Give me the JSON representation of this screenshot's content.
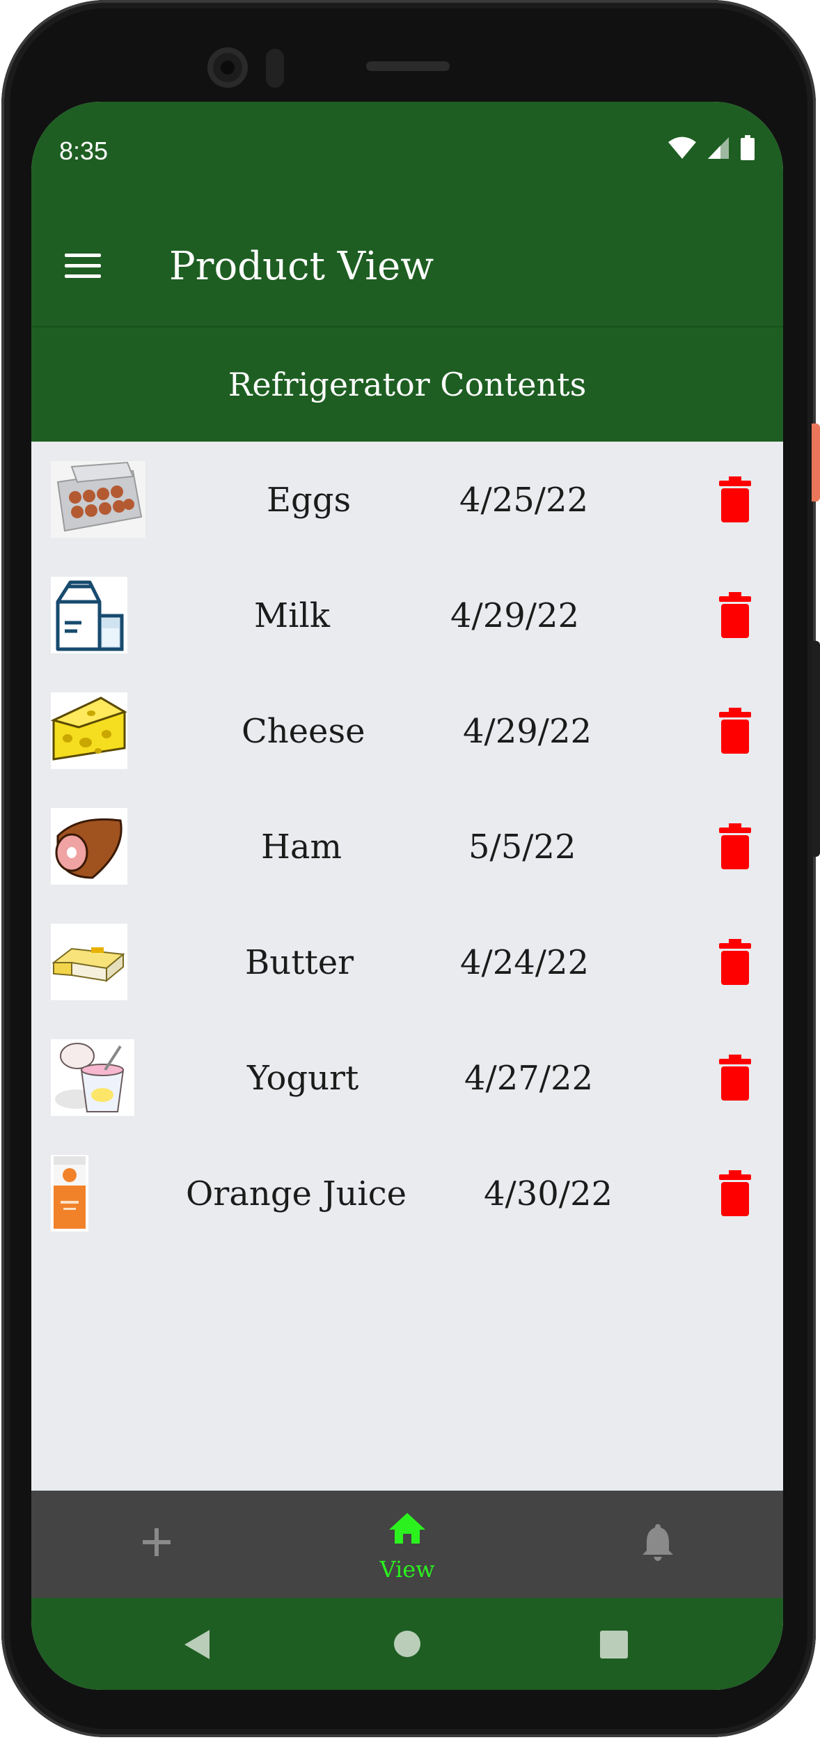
{
  "status_bar": {
    "time": "8:35"
  },
  "app_bar": {
    "title": "Product View",
    "menu_icon": "hamburger-menu-icon"
  },
  "subheader": {
    "title": "Refrigerator Contents"
  },
  "products": [
    {
      "name": "Eggs",
      "date": "4/25/22",
      "image": "eggs-carton"
    },
    {
      "name": "Milk",
      "date": "4/29/22",
      "image": "milk-carton"
    },
    {
      "name": "Cheese",
      "date": "4/29/22",
      "image": "cheese-wedge"
    },
    {
      "name": "Ham",
      "date": "5/5/22",
      "image": "ham"
    },
    {
      "name": "Butter",
      "date": "4/24/22",
      "image": "butter-stick"
    },
    {
      "name": "Yogurt",
      "date": "4/27/22",
      "image": "yogurt-cup"
    },
    {
      "name": "Orange Juice",
      "date": "4/30/22",
      "image": "orange-juice-carton"
    }
  ],
  "bottom_nav": {
    "items": [
      {
        "icon": "add-icon",
        "label": "",
        "active": false
      },
      {
        "icon": "home-icon",
        "label": "View",
        "active": true
      },
      {
        "icon": "bell-icon",
        "label": "",
        "active": false
      }
    ]
  },
  "colors": {
    "primary": "#1e5e22",
    "nav_background": "#444444",
    "list_background": "#e9ebee",
    "active": "#2bf21e",
    "delete": "#ff0000"
  }
}
